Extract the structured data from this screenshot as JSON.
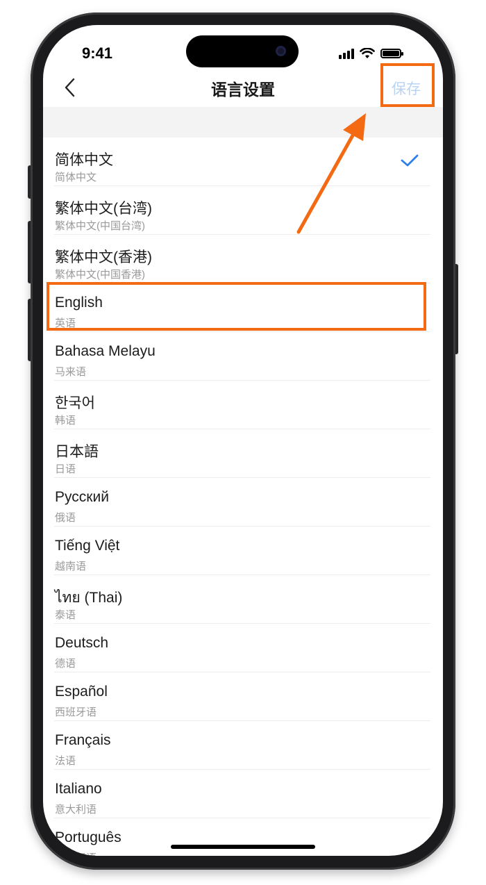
{
  "status_bar": {
    "time": "9:41"
  },
  "nav": {
    "title": "语言设置",
    "save_label": "保存"
  },
  "colors": {
    "accent": "#2d7fe8",
    "highlight": "#f36a12",
    "save_disabled": "#b9d3f2"
  },
  "languages": [
    {
      "name": "简体中文",
      "sub": "简体中文",
      "selected": true
    },
    {
      "name": "繁体中文(台湾)",
      "sub": "繁体中文(中国台湾)"
    },
    {
      "name": "繁体中文(香港)",
      "sub": "繁体中文(中国香港)"
    },
    {
      "name": "English",
      "sub": "英语"
    },
    {
      "name": "Bahasa Melayu",
      "sub": "马来语"
    },
    {
      "name": "한국어",
      "sub": "韩语"
    },
    {
      "name": "日本語",
      "sub": "日语"
    },
    {
      "name": "Русский",
      "sub": "俄语"
    },
    {
      "name": "Tiếng Việt",
      "sub": "越南语"
    },
    {
      "name": "ไทย (Thai)",
      "sub": "泰语"
    },
    {
      "name": "Deutsch",
      "sub": "德语"
    },
    {
      "name": "Español",
      "sub": "西班牙语"
    },
    {
      "name": "Français",
      "sub": "法语"
    },
    {
      "name": "Italiano",
      "sub": "意大利语"
    },
    {
      "name": "Português",
      "sub": "葡萄牙语"
    }
  ]
}
